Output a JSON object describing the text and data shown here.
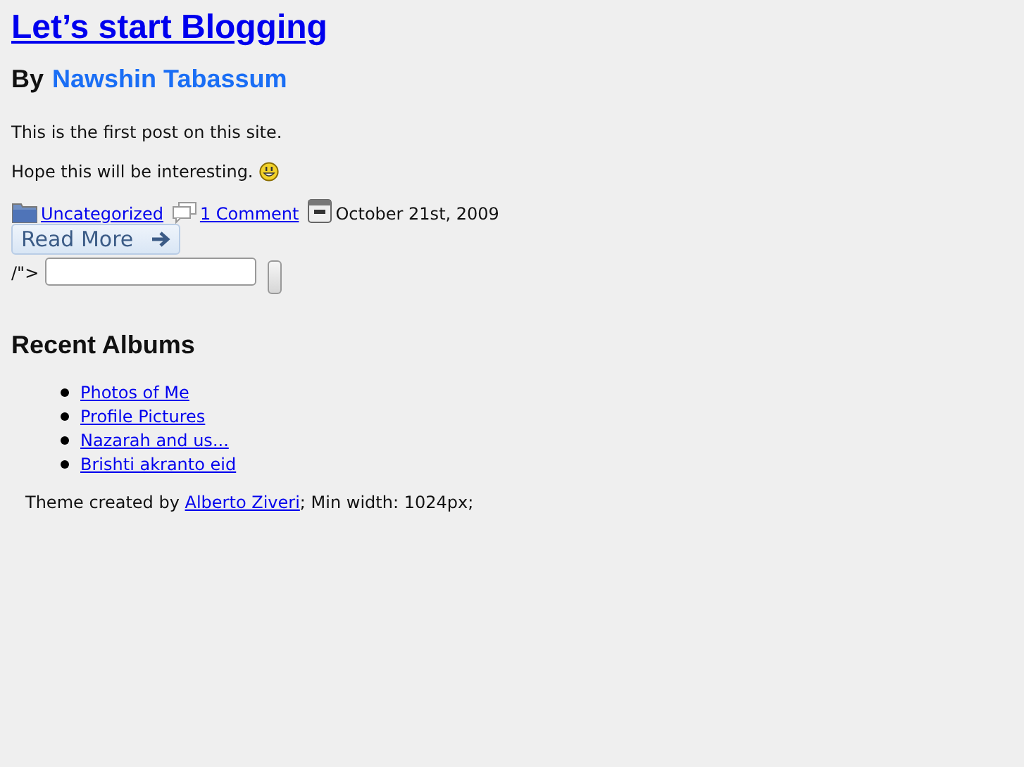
{
  "post": {
    "title": "Let’s start Blogging",
    "byline_prefix": "By",
    "author": "Nawshin Tabassum",
    "paragraphs": [
      "This is the first post on this site.",
      "Hope this will be interesting."
    ],
    "meta": {
      "category": "Uncategorized",
      "comments": "1 Comment",
      "date": "October 21st, 2009"
    },
    "read_more": "Read More",
    "stray_text": "/\">"
  },
  "sidebar": {
    "heading": "Recent Albums",
    "albums": [
      "Photos of Me",
      "Profile Pictures",
      "Nazarah and us...",
      "Brishti akranto eid"
    ]
  },
  "footer": {
    "before": "Theme created by ",
    "link": "Alberto Ziveri",
    "after": "; Min width: 1024px;"
  }
}
